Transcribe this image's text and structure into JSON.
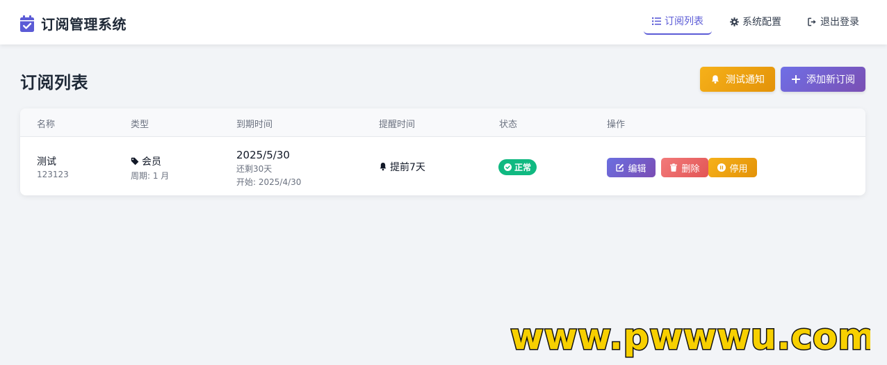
{
  "app": {
    "title": "订阅管理系统"
  },
  "nav": {
    "items": [
      {
        "label": "订阅列表",
        "icon": "list-icon",
        "active": true
      },
      {
        "label": "系统配置",
        "icon": "gear-icon",
        "active": false
      },
      {
        "label": "退出登录",
        "icon": "sign-out-icon",
        "active": false
      }
    ]
  },
  "page": {
    "title": "订阅列表",
    "test_notify_label": "测试通知",
    "add_label": "添加新订阅"
  },
  "table": {
    "headers": [
      "名称",
      "类型",
      "到期时间",
      "提醒时间",
      "状态",
      "操作"
    ],
    "rows": [
      {
        "name": "测试",
        "note": "123123",
        "type": "会员",
        "cycle": "周期: 1 月",
        "expire_date": "2025/5/30",
        "remaining": "还剩30天",
        "start": "开始: 2025/4/30",
        "remind": "提前7天",
        "status": "正常",
        "actions": {
          "edit": "编辑",
          "delete": "删除",
          "disable": "停用"
        }
      }
    ]
  },
  "watermark": "www.pwwwu.com",
  "colors": {
    "accent": "#5b5bd6",
    "success": "#10b981",
    "warning": "#f6b11a",
    "danger": "#e25555",
    "watermark": "#f7d000"
  }
}
